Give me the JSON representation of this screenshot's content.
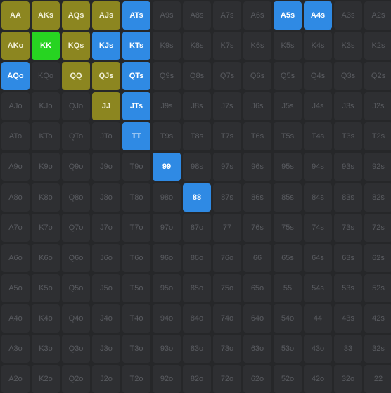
{
  "colors": {
    "background": "#262729",
    "cell_inactive": "#2e2f32",
    "text_inactive": "#595b60",
    "raise": "#8c8620",
    "call": "#2f8ae4",
    "allin": "#27d421"
  },
  "rows": [
    [
      {
        "label": "AA",
        "action": "raise"
      },
      {
        "label": "AKs",
        "action": "raise"
      },
      {
        "label": "AQs",
        "action": "raise"
      },
      {
        "label": "AJs",
        "action": "raise"
      },
      {
        "label": "ATs",
        "action": "call"
      },
      {
        "label": "A9s",
        "action": "none"
      },
      {
        "label": "A8s",
        "action": "none"
      },
      {
        "label": "A7s",
        "action": "none"
      },
      {
        "label": "A6s",
        "action": "none"
      },
      {
        "label": "A5s",
        "action": "call"
      },
      {
        "label": "A4s",
        "action": "call"
      },
      {
        "label": "A3s",
        "action": "none"
      },
      {
        "label": "A2s",
        "action": "none"
      }
    ],
    [
      {
        "label": "AKo",
        "action": "raise"
      },
      {
        "label": "KK",
        "action": "allin"
      },
      {
        "label": "KQs",
        "action": "raise"
      },
      {
        "label": "KJs",
        "action": "call"
      },
      {
        "label": "KTs",
        "action": "call"
      },
      {
        "label": "K9s",
        "action": "none"
      },
      {
        "label": "K8s",
        "action": "none"
      },
      {
        "label": "K7s",
        "action": "none"
      },
      {
        "label": "K6s",
        "action": "none"
      },
      {
        "label": "K5s",
        "action": "none"
      },
      {
        "label": "K4s",
        "action": "none"
      },
      {
        "label": "K3s",
        "action": "none"
      },
      {
        "label": "K2s",
        "action": "none"
      }
    ],
    [
      {
        "label": "AQo",
        "action": "call"
      },
      {
        "label": "KQo",
        "action": "none"
      },
      {
        "label": "QQ",
        "action": "raise"
      },
      {
        "label": "QJs",
        "action": "raise"
      },
      {
        "label": "QTs",
        "action": "call"
      },
      {
        "label": "Q9s",
        "action": "none"
      },
      {
        "label": "Q8s",
        "action": "none"
      },
      {
        "label": "Q7s",
        "action": "none"
      },
      {
        "label": "Q6s",
        "action": "none"
      },
      {
        "label": "Q5s",
        "action": "none"
      },
      {
        "label": "Q4s",
        "action": "none"
      },
      {
        "label": "Q3s",
        "action": "none"
      },
      {
        "label": "Q2s",
        "action": "none"
      }
    ],
    [
      {
        "label": "AJo",
        "action": "none"
      },
      {
        "label": "KJo",
        "action": "none"
      },
      {
        "label": "QJo",
        "action": "none"
      },
      {
        "label": "JJ",
        "action": "raise"
      },
      {
        "label": "JTs",
        "action": "call"
      },
      {
        "label": "J9s",
        "action": "none"
      },
      {
        "label": "J8s",
        "action": "none"
      },
      {
        "label": "J7s",
        "action": "none"
      },
      {
        "label": "J6s",
        "action": "none"
      },
      {
        "label": "J5s",
        "action": "none"
      },
      {
        "label": "J4s",
        "action": "none"
      },
      {
        "label": "J3s",
        "action": "none"
      },
      {
        "label": "J2s",
        "action": "none"
      }
    ],
    [
      {
        "label": "ATo",
        "action": "none"
      },
      {
        "label": "KTo",
        "action": "none"
      },
      {
        "label": "QTo",
        "action": "none"
      },
      {
        "label": "JTo",
        "action": "none"
      },
      {
        "label": "TT",
        "action": "call"
      },
      {
        "label": "T9s",
        "action": "none"
      },
      {
        "label": "T8s",
        "action": "none"
      },
      {
        "label": "T7s",
        "action": "none"
      },
      {
        "label": "T6s",
        "action": "none"
      },
      {
        "label": "T5s",
        "action": "none"
      },
      {
        "label": "T4s",
        "action": "none"
      },
      {
        "label": "T3s",
        "action": "none"
      },
      {
        "label": "T2s",
        "action": "none"
      }
    ],
    [
      {
        "label": "A9o",
        "action": "none"
      },
      {
        "label": "K9o",
        "action": "none"
      },
      {
        "label": "Q9o",
        "action": "none"
      },
      {
        "label": "J9o",
        "action": "none"
      },
      {
        "label": "T9o",
        "action": "none"
      },
      {
        "label": "99",
        "action": "call"
      },
      {
        "label": "98s",
        "action": "none"
      },
      {
        "label": "97s",
        "action": "none"
      },
      {
        "label": "96s",
        "action": "none"
      },
      {
        "label": "95s",
        "action": "none"
      },
      {
        "label": "94s",
        "action": "none"
      },
      {
        "label": "93s",
        "action": "none"
      },
      {
        "label": "92s",
        "action": "none"
      }
    ],
    [
      {
        "label": "A8o",
        "action": "none"
      },
      {
        "label": "K8o",
        "action": "none"
      },
      {
        "label": "Q8o",
        "action": "none"
      },
      {
        "label": "J8o",
        "action": "none"
      },
      {
        "label": "T8o",
        "action": "none"
      },
      {
        "label": "98o",
        "action": "none"
      },
      {
        "label": "88",
        "action": "call"
      },
      {
        "label": "87s",
        "action": "none"
      },
      {
        "label": "86s",
        "action": "none"
      },
      {
        "label": "85s",
        "action": "none"
      },
      {
        "label": "84s",
        "action": "none"
      },
      {
        "label": "83s",
        "action": "none"
      },
      {
        "label": "82s",
        "action": "none"
      }
    ],
    [
      {
        "label": "A7o",
        "action": "none"
      },
      {
        "label": "K7o",
        "action": "none"
      },
      {
        "label": "Q7o",
        "action": "none"
      },
      {
        "label": "J7o",
        "action": "none"
      },
      {
        "label": "T7o",
        "action": "none"
      },
      {
        "label": "97o",
        "action": "none"
      },
      {
        "label": "87o",
        "action": "none"
      },
      {
        "label": "77",
        "action": "none"
      },
      {
        "label": "76s",
        "action": "none"
      },
      {
        "label": "75s",
        "action": "none"
      },
      {
        "label": "74s",
        "action": "none"
      },
      {
        "label": "73s",
        "action": "none"
      },
      {
        "label": "72s",
        "action": "none"
      }
    ],
    [
      {
        "label": "A6o",
        "action": "none"
      },
      {
        "label": "K6o",
        "action": "none"
      },
      {
        "label": "Q6o",
        "action": "none"
      },
      {
        "label": "J6o",
        "action": "none"
      },
      {
        "label": "T6o",
        "action": "none"
      },
      {
        "label": "96o",
        "action": "none"
      },
      {
        "label": "86o",
        "action": "none"
      },
      {
        "label": "76o",
        "action": "none"
      },
      {
        "label": "66",
        "action": "none"
      },
      {
        "label": "65s",
        "action": "none"
      },
      {
        "label": "64s",
        "action": "none"
      },
      {
        "label": "63s",
        "action": "none"
      },
      {
        "label": "62s",
        "action": "none"
      }
    ],
    [
      {
        "label": "A5o",
        "action": "none"
      },
      {
        "label": "K5o",
        "action": "none"
      },
      {
        "label": "Q5o",
        "action": "none"
      },
      {
        "label": "J5o",
        "action": "none"
      },
      {
        "label": "T5o",
        "action": "none"
      },
      {
        "label": "95o",
        "action": "none"
      },
      {
        "label": "85o",
        "action": "none"
      },
      {
        "label": "75o",
        "action": "none"
      },
      {
        "label": "65o",
        "action": "none"
      },
      {
        "label": "55",
        "action": "none"
      },
      {
        "label": "54s",
        "action": "none"
      },
      {
        "label": "53s",
        "action": "none"
      },
      {
        "label": "52s",
        "action": "none"
      }
    ],
    [
      {
        "label": "A4o",
        "action": "none"
      },
      {
        "label": "K4o",
        "action": "none"
      },
      {
        "label": "Q4o",
        "action": "none"
      },
      {
        "label": "J4o",
        "action": "none"
      },
      {
        "label": "T4o",
        "action": "none"
      },
      {
        "label": "94o",
        "action": "none"
      },
      {
        "label": "84o",
        "action": "none"
      },
      {
        "label": "74o",
        "action": "none"
      },
      {
        "label": "64o",
        "action": "none"
      },
      {
        "label": "54o",
        "action": "none"
      },
      {
        "label": "44",
        "action": "none"
      },
      {
        "label": "43s",
        "action": "none"
      },
      {
        "label": "42s",
        "action": "none"
      }
    ],
    [
      {
        "label": "A3o",
        "action": "none"
      },
      {
        "label": "K3o",
        "action": "none"
      },
      {
        "label": "Q3o",
        "action": "none"
      },
      {
        "label": "J3o",
        "action": "none"
      },
      {
        "label": "T3o",
        "action": "none"
      },
      {
        "label": "93o",
        "action": "none"
      },
      {
        "label": "83o",
        "action": "none"
      },
      {
        "label": "73o",
        "action": "none"
      },
      {
        "label": "63o",
        "action": "none"
      },
      {
        "label": "53o",
        "action": "none"
      },
      {
        "label": "43o",
        "action": "none"
      },
      {
        "label": "33",
        "action": "none"
      },
      {
        "label": "32s",
        "action": "none"
      }
    ],
    [
      {
        "label": "A2o",
        "action": "none"
      },
      {
        "label": "K2o",
        "action": "none"
      },
      {
        "label": "Q2o",
        "action": "none"
      },
      {
        "label": "J2o",
        "action": "none"
      },
      {
        "label": "T2o",
        "action": "none"
      },
      {
        "label": "92o",
        "action": "none"
      },
      {
        "label": "82o",
        "action": "none"
      },
      {
        "label": "72o",
        "action": "none"
      },
      {
        "label": "62o",
        "action": "none"
      },
      {
        "label": "52o",
        "action": "none"
      },
      {
        "label": "42o",
        "action": "none"
      },
      {
        "label": "32o",
        "action": "none"
      },
      {
        "label": "22",
        "action": "none"
      }
    ]
  ]
}
